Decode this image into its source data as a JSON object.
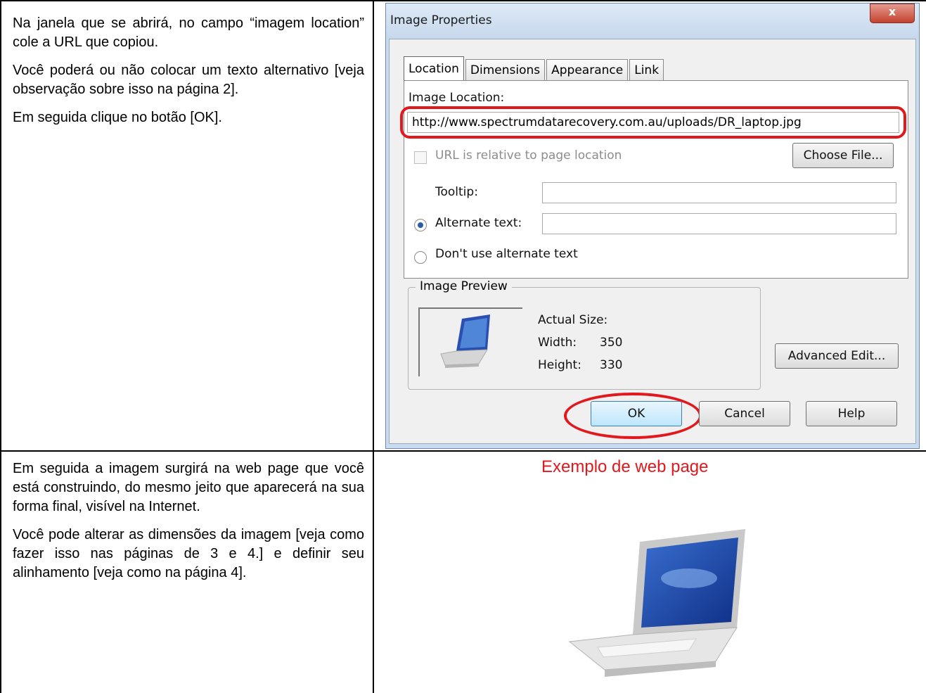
{
  "left_text_top": [
    "Na janela que se abrirá, no campo “imagem location” cole a URL que copiou.",
    "Você poderá ou não colocar um texto alternativo [veja observação sobre isso na página 2].",
    "Em seguida clique no botão [OK]."
  ],
  "left_text_bottom": [
    "Em seguida a imagem surgirá na web page que você está construindo, do mesmo jeito que aparecerá na sua forma final, visível na Internet.",
    "Você pode alterar as dimensões da imagem [veja como fazer isso nas páginas de 3 e 4.] e definir seu alinhamento [veja como na página 4]."
  ],
  "dialog": {
    "title": "Image Properties",
    "close_label": "x",
    "tabs": [
      "Location",
      "Dimensions",
      "Appearance",
      "Link"
    ],
    "image_location_label": "Image Location:",
    "image_location_value": "http://www.spectrumdatarecovery.com.au/uploads/DR_laptop.jpg",
    "relative_checkbox_label": "URL is relative to page location",
    "choose_file_label": "Choose File...",
    "tooltip_label": "Tooltip:",
    "alternate_text_label": "Alternate text:",
    "dont_use_alt_label": "Don't use alternate text",
    "preview_group_label": "Image Preview",
    "actual_size_label": "Actual Size:",
    "width_label": "Width:",
    "width_value": "350",
    "height_label": "Height:",
    "height_value": "330",
    "advanced_edit_label": "Advanced Edit...",
    "ok_label": "OK",
    "cancel_label": "Cancel",
    "help_label": "Help"
  },
  "example": {
    "title": "Exemplo de web page"
  },
  "colors": {
    "annotation_red": "#e1191e",
    "dialog_frame": "#c9dbee"
  }
}
